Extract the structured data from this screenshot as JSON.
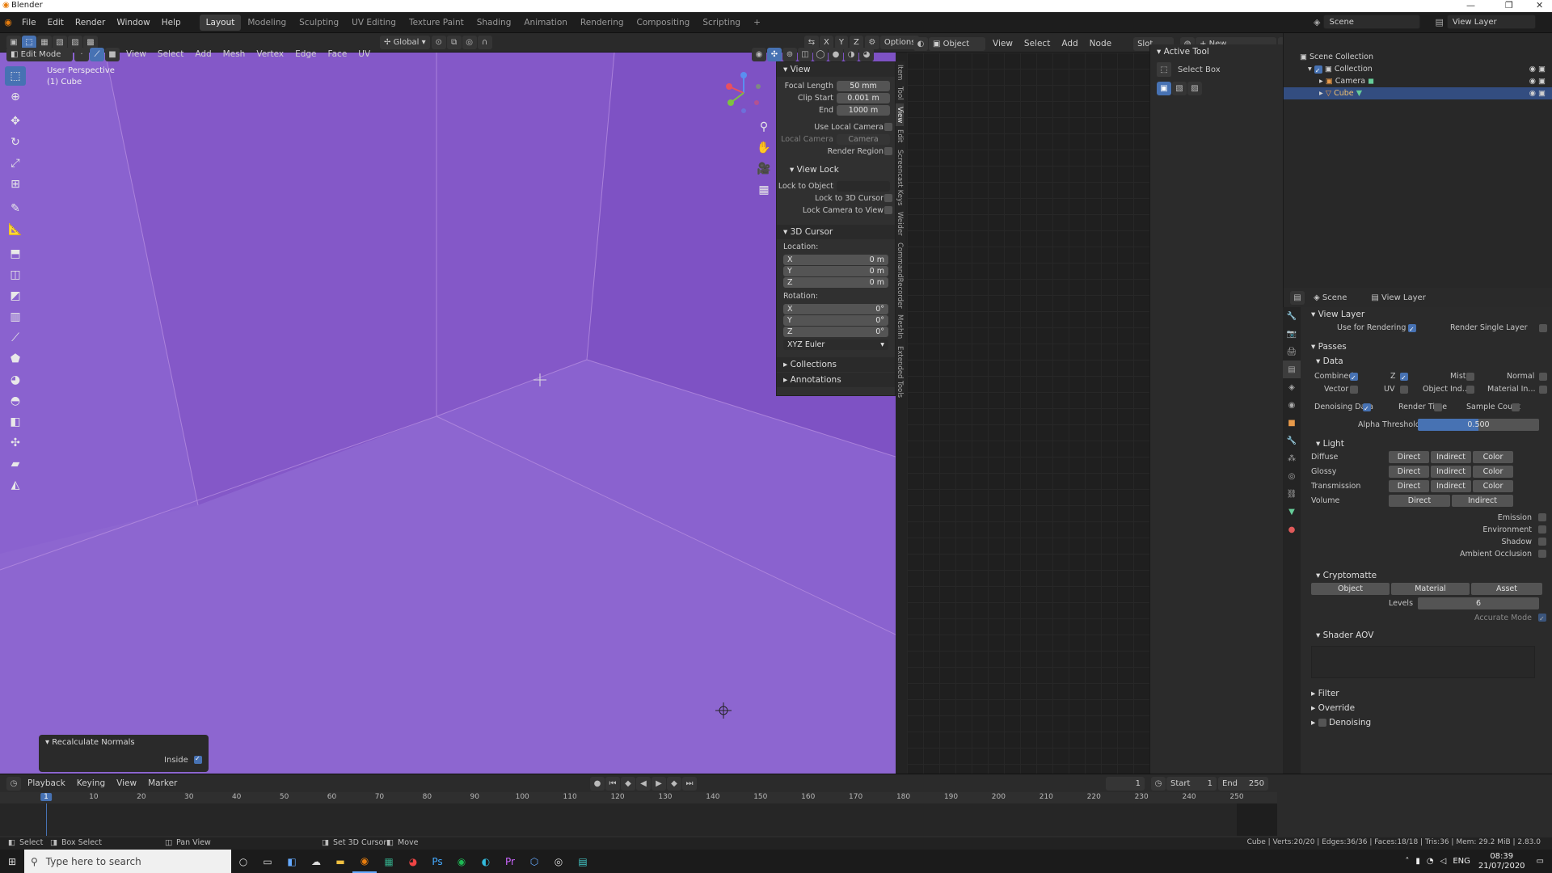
{
  "window": {
    "title": "Blender"
  },
  "menu": [
    "File",
    "Edit",
    "Render",
    "Window",
    "Help"
  ],
  "workspaces": [
    "Layout",
    "Modeling",
    "Sculpting",
    "UV Editing",
    "Texture Paint",
    "Shading",
    "Animation",
    "Rendering",
    "Compositing",
    "Scripting"
  ],
  "scene": {
    "scene_label": "Scene",
    "view_layer_label": "View Layer"
  },
  "viewport_header": {
    "mode": "Edit Mode",
    "menus": [
      "View",
      "Select",
      "Add",
      "Mesh",
      "Vertex",
      "Edge",
      "Face",
      "UV"
    ],
    "transform_orientation": "Global",
    "options_label": "Options",
    "axes": [
      "X",
      "Y",
      "Z"
    ]
  },
  "viewport": {
    "perspective": "User Perspective",
    "object": "(1) Cube",
    "bg_color": "#8a62cf"
  },
  "redo_panel": {
    "title": "Recalculate Normals",
    "inside_label": "Inside",
    "inside": true
  },
  "npanel": {
    "view_header": "View",
    "focal_length_label": "Focal Length",
    "focal_length": "50 mm",
    "clip_start_label": "Clip Start",
    "clip_start": "0.001 m",
    "end_label": "End",
    "end": "1000 m",
    "use_local_camera": "Use Local Camera",
    "local_camera_label": "Local Camera",
    "local_camera": "Camera",
    "render_region": "Render Region",
    "view_lock_header": "View Lock",
    "lock_to_object": "Lock to Object",
    "lock_to_3d_cursor": "Lock to 3D Cursor",
    "lock_camera_to_view": "Lock Camera to View",
    "cursor_header": "3D Cursor",
    "location_label": "Location:",
    "loc_x": "0 m",
    "loc_y": "0 m",
    "loc_z": "0 m",
    "rotation_label": "Rotation:",
    "rot_x": "0°",
    "rot_y": "0°",
    "rot_z": "0°",
    "rotation_mode": "XYZ Euler",
    "collections": "Collections",
    "annotations": "Annotations",
    "tabs": [
      "Item",
      "Tool",
      "View",
      "Edit",
      "Screencast Keys",
      "Weider",
      "CommandRecorder",
      "MeshIn",
      "Extended Tools"
    ]
  },
  "node_editor": {
    "object_label": "Object",
    "menus": [
      "View",
      "Select",
      "Add",
      "Node"
    ],
    "slot_label": "Slot",
    "new_label": "New"
  },
  "active_tool": {
    "header": "Active Tool",
    "tool_name": "Select Box"
  },
  "outliner": {
    "rows": [
      {
        "label": "Scene Collection"
      },
      {
        "label": "Collection"
      },
      {
        "label": "Camera"
      },
      {
        "label": "Cube"
      }
    ]
  },
  "properties": {
    "scene_label": "Scene",
    "view_layer_label": "View Layer",
    "view_layer_header": "View Layer",
    "use_for_rendering": "Use for Rendering",
    "render_single_layer": "Render Single Layer",
    "passes": "Passes",
    "data": "Data",
    "combined": "Combined",
    "z": "Z",
    "mist": "Mist",
    "normal": "Normal",
    "vector": "Vector",
    "uv": "UV",
    "object_ind": "Object Ind...",
    "material_in": "Material In...",
    "denoising_data": "Denoising Data",
    "render_time": "Render Time",
    "sample_count": "Sample Count",
    "alpha_threshold_label": "Alpha Threshold",
    "alpha_threshold": "0.500",
    "light": "Light",
    "light_rows": [
      "Diffuse",
      "Glossy",
      "Transmission"
    ],
    "volume": "Volume",
    "direct": "Direct",
    "indirect": "Indirect",
    "color": "Color",
    "emission": "Emission",
    "environment": "Environment",
    "shadow": "Shadow",
    "ambient_occlusion": "Ambient Occlusion",
    "cryptomatte": "Cryptomatte",
    "crypto_object": "Object",
    "crypto_material": "Material",
    "crypto_asset": "Asset",
    "levels_label": "Levels",
    "levels": "6",
    "accurate_mode": "Accurate Mode",
    "shader_aov": "Shader AOV",
    "filter": "Filter",
    "override": "Override",
    "denoising": "Denoising"
  },
  "timeline": {
    "menus": [
      "Playback",
      "Keying",
      "View",
      "Marker"
    ],
    "current_frame": "1",
    "start_label": "Start",
    "start": "1",
    "end_label": "End",
    "end": "250",
    "ticks": [
      "1",
      "10",
      "20",
      "30",
      "40",
      "50",
      "60",
      "70",
      "80",
      "90",
      "100",
      "110",
      "120",
      "130",
      "140",
      "150",
      "160",
      "170",
      "180",
      "190",
      "200",
      "210",
      "220",
      "230",
      "240",
      "250"
    ]
  },
  "statusbar": {
    "select": "Select",
    "box_select": "Box Select",
    "pan_view": "Pan View",
    "set_3d_cursor": "Set 3D Cursor",
    "move": "Move",
    "stats": "Cube | Verts:20/20 | Edges:36/36 | Faces:18/18 | Tris:36 | Mem: 29.2 MiB | 2.83.0"
  },
  "taskbar": {
    "search_placeholder": "Type here to search",
    "time": "08:39",
    "date": "21/07/2020",
    "lang": "ENG"
  }
}
